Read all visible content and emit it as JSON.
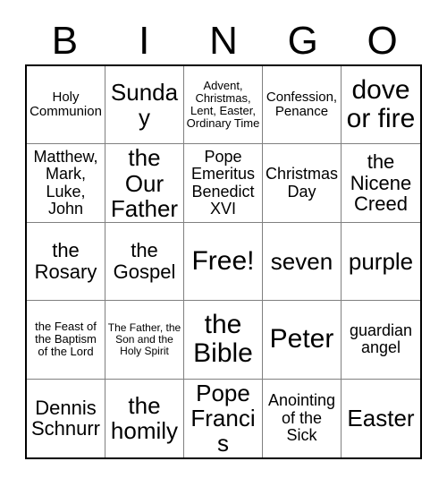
{
  "card": {
    "title_letters": [
      "B",
      "I",
      "N",
      "G",
      "O"
    ],
    "columns": 5,
    "rows": 5,
    "free_space_label": "Free!",
    "free_space_position": "center",
    "colors": {
      "background": "#ffffff",
      "text": "#000000",
      "outer_border": "#000000",
      "inner_grid_line": "#808080"
    },
    "cells": [
      {
        "text": "Holy Communion",
        "size": "fs-s",
        "column": "B",
        "row": 1
      },
      {
        "text": "Sunday",
        "size": "fs-xl",
        "column": "I",
        "row": 1
      },
      {
        "text": "Advent, Christmas, Lent, Easter, Ordinary Time",
        "size": "fs-xs",
        "column": "N",
        "row": 1
      },
      {
        "text": "Confession, Penance",
        "size": "fs-s",
        "column": "G",
        "row": 1
      },
      {
        "text": "dove or fire",
        "size": "fs-xxl",
        "column": "O",
        "row": 1
      },
      {
        "text": "Matthew, Mark, Luke, John",
        "size": "fs-m",
        "column": "B",
        "row": 2
      },
      {
        "text": "the Our Father",
        "size": "fs-xl",
        "column": "I",
        "row": 2
      },
      {
        "text": "Pope Emeritus Benedict XVI",
        "size": "fs-m",
        "column": "N",
        "row": 2
      },
      {
        "text": "Christmas Day",
        "size": "fs-m",
        "column": "G",
        "row": 2
      },
      {
        "text": "the Nicene Creed",
        "size": "fs-l",
        "column": "O",
        "row": 2
      },
      {
        "text": "the Rosary",
        "size": "fs-l",
        "column": "B",
        "row": 3
      },
      {
        "text": "the Gospel",
        "size": "fs-l",
        "column": "I",
        "row": 3
      },
      {
        "text": "Free!",
        "size": "fs-xxl",
        "column": "N",
        "row": 3
      },
      {
        "text": "seven",
        "size": "fs-xl",
        "column": "G",
        "row": 3
      },
      {
        "text": "purple",
        "size": "fs-xl",
        "column": "O",
        "row": 3
      },
      {
        "text": "the Feast of the Baptism of the Lord",
        "size": "fs-xs",
        "column": "B",
        "row": 4
      },
      {
        "text": "The Father, the Son and the Holy Spirit",
        "size": "fs-xxs",
        "column": "I",
        "row": 4
      },
      {
        "text": "the Bible",
        "size": "fs-xxl",
        "column": "N",
        "row": 4
      },
      {
        "text": "Peter",
        "size": "fs-xxl",
        "column": "G",
        "row": 4
      },
      {
        "text": "guardian angel",
        "size": "fs-m",
        "column": "O",
        "row": 4
      },
      {
        "text": "Dennis Schnurr",
        "size": "fs-l",
        "column": "B",
        "row": 5
      },
      {
        "text": "the homily",
        "size": "fs-xl",
        "column": "I",
        "row": 5
      },
      {
        "text": "Pope Francis",
        "size": "fs-xl",
        "column": "N",
        "row": 5
      },
      {
        "text": "Anointing of the Sick",
        "size": "fs-m",
        "column": "G",
        "row": 5
      },
      {
        "text": "Easter",
        "size": "fs-xl",
        "column": "O",
        "row": 5
      }
    ]
  }
}
